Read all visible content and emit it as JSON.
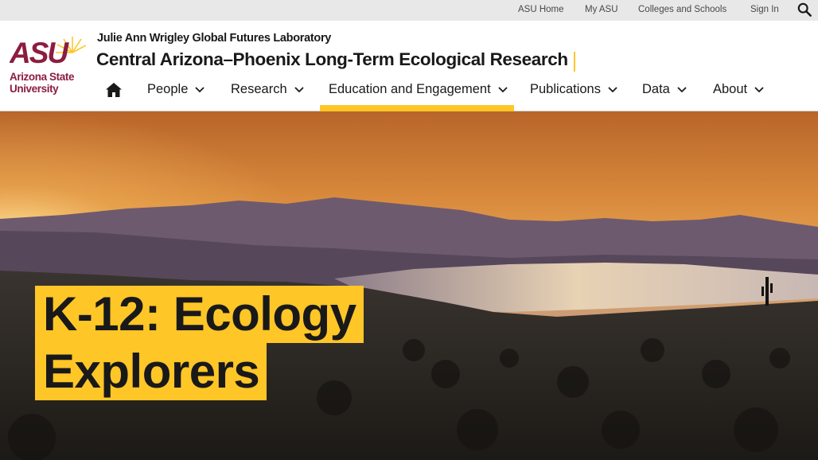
{
  "utility_nav": {
    "links": [
      "ASU Home",
      "My ASU",
      "Colleges and Schools",
      "Sign In"
    ],
    "search_icon": "search-icon"
  },
  "header": {
    "logo_mark": "ASU",
    "logo_text_1": "Arizona State",
    "logo_text_2": "University",
    "unit_name": "Julie Ann Wrigley Global Futures Laboratory",
    "site_title": "Central Arizona–Phoenix Long-Term Ecological Research"
  },
  "nav": {
    "home_icon": "home-icon",
    "items": [
      {
        "label": "People"
      },
      {
        "label": "Research"
      },
      {
        "label": "Education and Engagement",
        "active": true
      },
      {
        "label": "Publications"
      },
      {
        "label": "Data"
      },
      {
        "label": "About"
      }
    ]
  },
  "hero": {
    "heading_line_1": "K-12: Ecology",
    "heading_line_2": "Explorers"
  },
  "colors": {
    "asu_maroon": "#8c1d40",
    "asu_gold": "#ffc627",
    "utility_bg": "#e8e8e8",
    "text": "#191919"
  }
}
